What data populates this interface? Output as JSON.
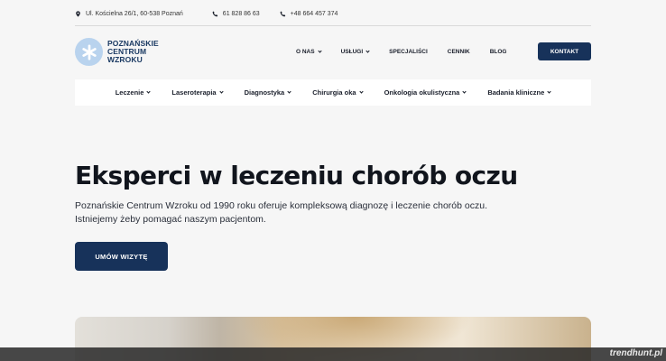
{
  "topbar": {
    "address": "Ul. Kościelna 26/1, 60-538 Poznań",
    "phone1": "61 828 86 63",
    "phone2": "+48 664 457 374"
  },
  "logo": {
    "line1": "POZNAŃSKIE",
    "line2": "CENTRUM",
    "line3": "WZROKU"
  },
  "main_nav": {
    "items": [
      "O NAS",
      "USŁUGI",
      "SPECJALIŚCI",
      "CENNIK",
      "BLOG"
    ],
    "contact_label": "KONTAKT"
  },
  "sub_nav": {
    "items": [
      "Leczenie",
      "Laseroterapia",
      "Diagnostyka",
      "Chirurgia oka",
      "Onkologia okulistyczna",
      "Badania kliniczne"
    ]
  },
  "hero": {
    "title": "Eksperci w leczeniu chorób oczu",
    "desc_line1": "Poznańskie Centrum Wzroku od 1990 roku oferuje kompleksową diagnozę i leczenie chorób oczu.",
    "desc_line2": "Istniejemy żeby pomagać naszym pacjentom.",
    "cta_label": "UMÓW WIZYTĘ"
  },
  "watermark": "trendhunt.pl",
  "colors": {
    "brand_navy": "#17325a",
    "logo_light_blue": "#b9d3ee",
    "background": "#f6f6f6"
  },
  "icons": {
    "address": "map-pin-icon",
    "phone": "phone-icon",
    "logo": "asterisk-logo-icon",
    "dropdown": "chevron-down-icon"
  }
}
